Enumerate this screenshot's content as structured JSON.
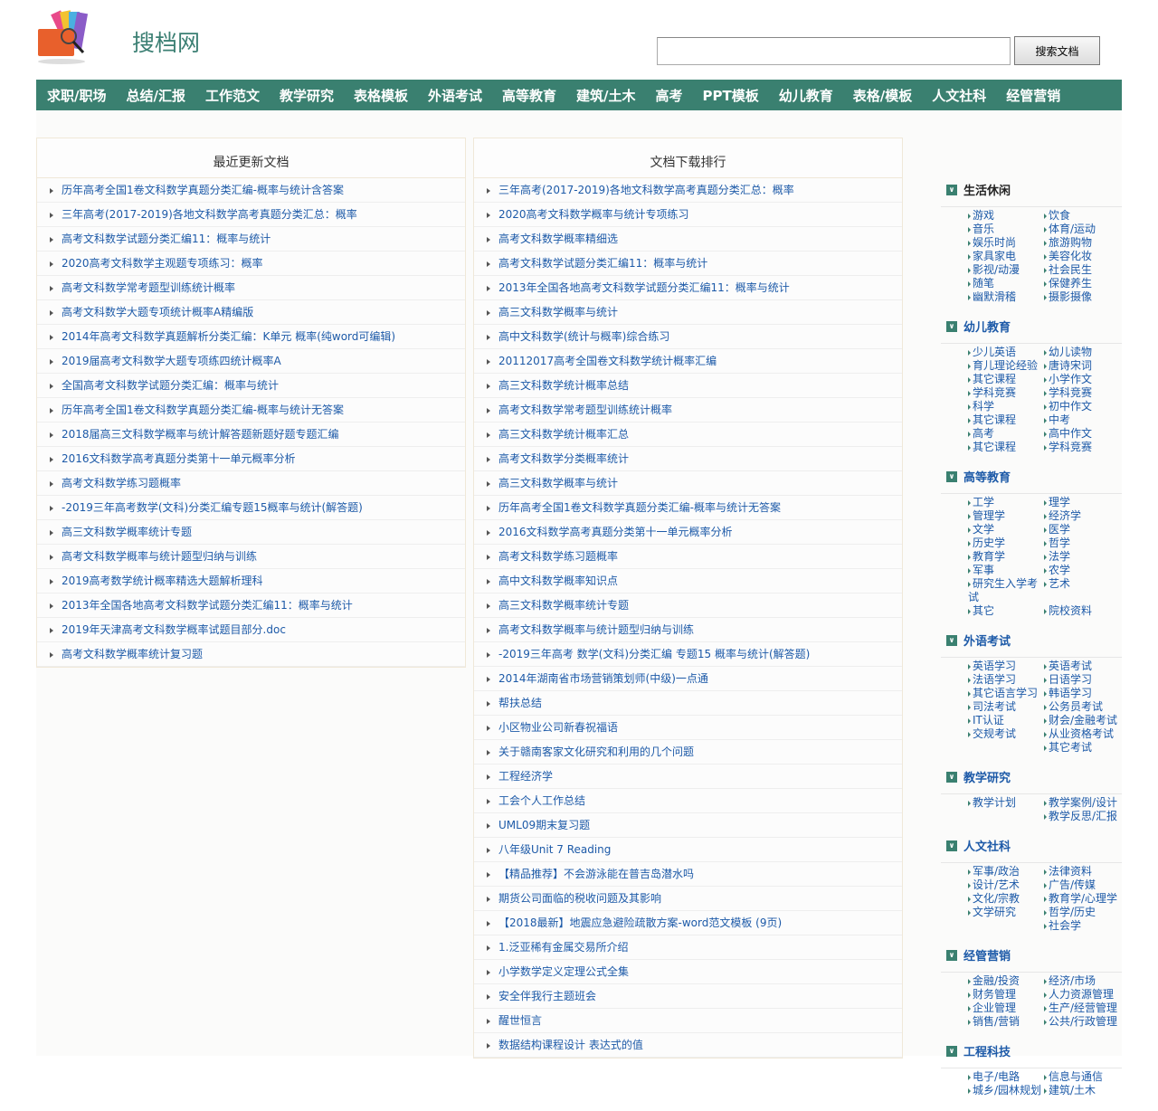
{
  "site": {
    "title": "搜档网",
    "search_button": "搜索文档",
    "search_placeholder": ""
  },
  "nav": [
    "求职/职场",
    "总结/汇报",
    "工作范文",
    "教学研究",
    "表格模板",
    "外语考试",
    "高等教育",
    "建筑/土木",
    "高考",
    "PPT模板",
    "幼儿教育",
    "表格/模板",
    "人文社科",
    "经管营销"
  ],
  "recent": {
    "title": "最近更新文档",
    "items": [
      "历年高考全国1卷文科数学真题分类汇编-概率与统计含答案",
      "三年高考(2017-2019)各地文科数学高考真题分类汇总：概率",
      "高考文科数学试题分类汇编11：概率与统计",
      "2020高考文科数学主观题专项练习：概率",
      "高考文科数学常考题型训练统计概率",
      "高考文科数学大题专项统计概率A精编版",
      "2014年高考文科数学真题解析分类汇编：K单元 概率(纯word可编辑)",
      "2019届高考文科数学大题专项练四统计概率A",
      "全国高考文科数学试题分类汇编：概率与统计",
      "历年高考全国1卷文科数学真题分类汇编-概率与统计无答案",
      "2018届高三文科数学概率与统计解答题新题好题专题汇编",
      "2016文科数学高考真题分类第十一单元概率分析",
      "高考文科数学练习题概率",
      "-2019三年高考数学(文科)分类汇编专题15概率与统计(解答题)",
      "高三文科数学概率统计专题",
      "高考文科数学概率与统计题型归纳与训练",
      "2019高考数学统计概率精选大题解析理科",
      "2013年全国各地高考文科数学试题分类汇编11：概率与统计",
      "2019年天津高考文科数学概率试题目部分.doc",
      "高考文科数学概率统计复习题"
    ]
  },
  "ranking": {
    "title": "文档下载排行",
    "items": [
      "三年高考(2017-2019)各地文科数学高考真题分类汇总：概率",
      "2020高考文科数学概率与统计专项练习",
      "高考文科数学概率精细选",
      "高考文科数学试题分类汇编11：概率与统计",
      "2013年全国各地高考文科数学试题分类汇编11：概率与统计",
      "高三文科数学概率与统计",
      "高中文科数学(统计与概率)综合练习",
      "20112017高考全国卷文科数学统计概率汇编",
      "高三文科数学统计概率总结",
      "高考文科数学常考题型训练统计概率",
      "高三文科数学统计概率汇总",
      "高考文科数学分类概率统计",
      "高三文科数学概率与统计",
      "历年高考全国1卷文科数学真题分类汇编-概率与统计无答案",
      "2016文科数学高考真题分类第十一单元概率分析",
      "高考文科数学练习题概率",
      "高中文科数学概率知识点",
      "高三文科数学概率统计专题",
      "高考文科数学概率与统计题型归纳与训练",
      "-2019三年高考 数学(文科)分类汇编 专题15 概率与统计(解答题)",
      "2014年湖南省市场营销策划师(中级)一点通",
      "帮扶总结",
      "小区物业公司新春祝福语",
      "关于赣南客家文化研究和利用的几个问题",
      "工程经济学",
      "工会个人工作总结",
      "UML09期末复习题",
      "八年级Unit 7 Reading",
      "【精品推荐】不会游泳能在普吉岛潜水吗",
      "期货公司面临的税收问题及其影响",
      "【2018最新】地震应急避险疏散方案-word范文模板 (9页)",
      "1.泛亚稀有金属交易所介绍",
      "小学数学定义定理公式全集",
      "安全伴我行主题班会",
      "醒世恒言",
      "数据结构课程设计 表达式的值"
    ]
  },
  "sidebar": [
    {
      "title": "生活休闲",
      "items": [
        "游戏",
        "饮食",
        "音乐",
        "体育/运动",
        "娱乐时尚",
        "旅游购物",
        "家具家电",
        "美容化妆",
        "影视/动漫",
        "社会民生",
        "随笔",
        "保健养生",
        "幽默滑稽",
        "摄影摄像"
      ]
    },
    {
      "title": "幼儿教育",
      "items": [
        "少儿英语",
        "幼儿读物",
        "育儿理论经验",
        "唐诗宋词",
        "其它课程",
        "小学作文",
        "学科竞赛",
        "学科竞赛",
        "科学",
        "初中作文",
        "其它课程",
        "中考",
        "高考",
        "高中作文",
        "其它课程",
        "学科竞赛"
      ]
    },
    {
      "title": "高等教育",
      "items": [
        "工学",
        "理学",
        "管理学",
        "经济学",
        "文学",
        "医学",
        "历史学",
        "哲学",
        "教育学",
        "法学",
        "军事",
        "农学",
        "研究生入学考试",
        "艺术",
        "其它",
        "院校资料"
      ]
    },
    {
      "title": "外语考试",
      "items": [
        "英语学习",
        "英语考试",
        "法语学习",
        "日语学习",
        "其它语言学习",
        "韩语学习",
        "司法考试",
        "公务员考试",
        "IT认证",
        "财会/金融考试",
        "交规考试",
        "从业资格考试",
        "",
        "其它考试"
      ]
    },
    {
      "title": "教学研究",
      "items": [
        "教学计划",
        "教学案例/设计",
        "",
        "教学反思/汇报"
      ]
    },
    {
      "title": "人文社科",
      "items": [
        "军事/政治",
        "法律资料",
        "设计/艺术",
        "广告/传媒",
        "文化/宗教",
        "教育学/心理学",
        "文学研究",
        "哲学/历史",
        "",
        "社会学"
      ]
    },
    {
      "title": "经管营销",
      "items": [
        "金融/投资",
        "经济/市场",
        "财务管理",
        "人力资源管理",
        "企业管理",
        "生产/经营管理",
        "销售/营销",
        "公共/行政管理"
      ]
    },
    {
      "title": "工程科技",
      "items": [
        "电子/电路",
        "信息与通信",
        "城乡/园林规划",
        "建筑/土木"
      ]
    }
  ]
}
